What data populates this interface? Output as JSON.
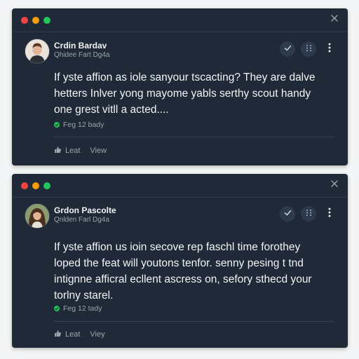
{
  "colors": {
    "window_bg": "#1f2937",
    "dot_red": "#ef4444",
    "dot_yellow": "#f59e0b",
    "dot_green": "#22c55e",
    "status_green": "#22c55e"
  },
  "posts": [
    {
      "author": "Crdin Bardav",
      "subtitle": "Qhidee Fart Dg4a",
      "body_lines": [
        "If yste affion as iole sanyour tscacting? They are dalve",
        "hetters Inlver yong mayome yabls serthy scout handy",
        "one grest vitll a acted...."
      ],
      "status": "Feg 12 bady",
      "like_label": "Lеat",
      "view_label": "View",
      "icons": {
        "check": "check-icon",
        "grid": "grid-icon",
        "more": "more-vertical-icon",
        "like": "thumbs-up-icon",
        "close": "close-icon"
      }
    },
    {
      "author": "Grdon Pascolte",
      "subtitle": "Qnlden Farl Dg4a",
      "body_lines": [
        "If yste affion us ioin secove rep faschl time forothey",
        "loped the feat will youtons tenfor. senny pesing t tnd",
        "intignne afficral ecllent ascress on, sefory sthecd your",
        "torlny starel."
      ],
      "status": "Feg 12 tady",
      "like_label": "Lеat",
      "view_label": "Viey",
      "icons": {
        "check": "check-icon",
        "grid": "grid-icon",
        "more": "more-vertical-icon",
        "like": "thumbs-up-icon",
        "close": "close-icon"
      }
    }
  ]
}
